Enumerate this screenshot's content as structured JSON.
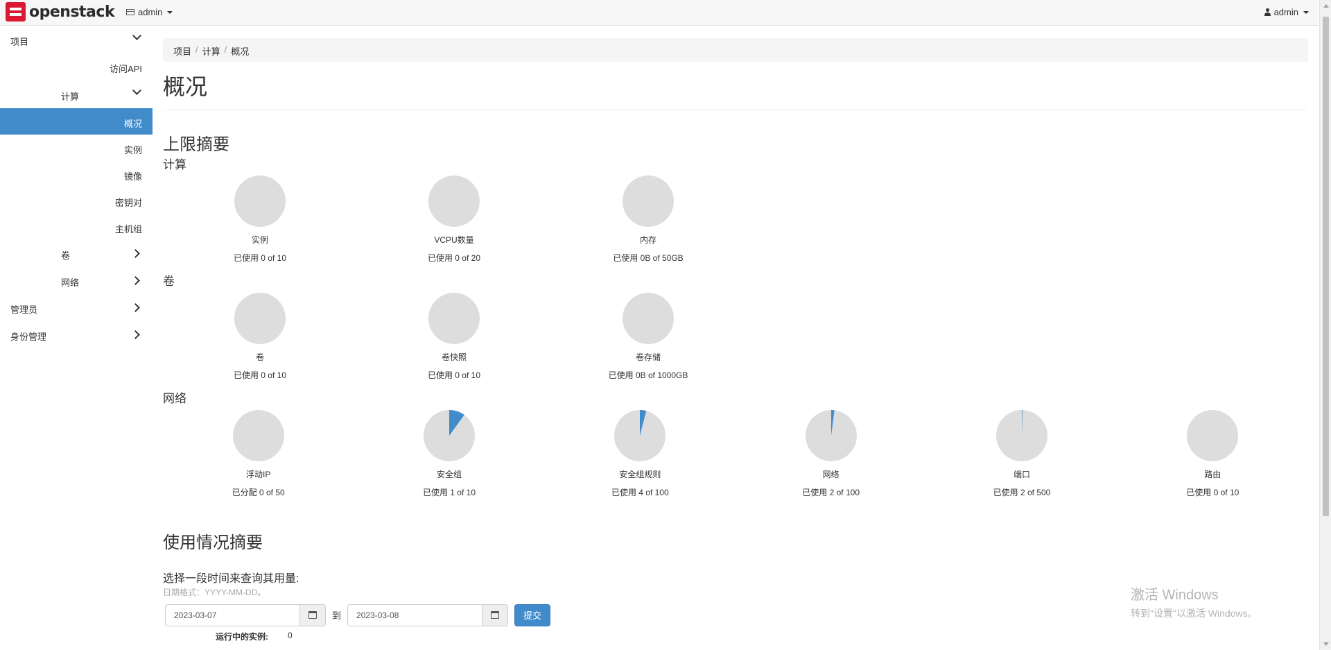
{
  "brand": {
    "name": "openstack"
  },
  "topbar": {
    "project_label": "admin",
    "user_label": "admin"
  },
  "sidebar": {
    "project": "项目",
    "api_access": "访问API",
    "compute": "计算",
    "compute_items": [
      "概况",
      "实例",
      "镜像",
      "密钥对",
      "主机组"
    ],
    "volumes": "卷",
    "network": "网络",
    "admin": "管理员",
    "identity": "身份管理"
  },
  "breadcrumb": [
    "项目",
    "计算",
    "概况"
  ],
  "page": {
    "title": "概况"
  },
  "limits": {
    "title": "上限摘要",
    "groups": [
      {
        "title": "计算",
        "items": [
          {
            "name": "实例",
            "usage": "已使用 0 of 10",
            "used": 0,
            "total": 10
          },
          {
            "name": "VCPU数量",
            "usage": "已使用 0 of 20",
            "used": 0,
            "total": 20
          },
          {
            "name": "内存",
            "usage": "已使用 0B of 50GB",
            "used": 0,
            "total": 50
          }
        ]
      },
      {
        "title": "卷",
        "items": [
          {
            "name": "卷",
            "usage": "已使用 0 of 10",
            "used": 0,
            "total": 10
          },
          {
            "name": "卷快照",
            "usage": "已使用 0 of 10",
            "used": 0,
            "total": 10
          },
          {
            "name": "卷存储",
            "usage": "已使用 0B of 1000GB",
            "used": 0,
            "total": 1000
          }
        ]
      },
      {
        "title": "网络",
        "items": [
          {
            "name": "浮动IP",
            "usage": "已分配 0 of 50",
            "used": 0,
            "total": 50
          },
          {
            "name": "安全组",
            "usage": "已使用 1 of 10",
            "used": 1,
            "total": 10
          },
          {
            "name": "安全组规则",
            "usage": "已使用 4 of 100",
            "used": 4,
            "total": 100
          },
          {
            "name": "网络",
            "usage": "已使用 2 of 100",
            "used": 2,
            "total": 100
          },
          {
            "name": "端口",
            "usage": "已使用 2 of 500",
            "used": 2,
            "total": 500
          },
          {
            "name": "路由",
            "usage": "已使用 0 of 10",
            "used": 0,
            "total": 10
          }
        ]
      }
    ],
    "colors": {
      "empty": "#dddddd",
      "used": "#428bca"
    }
  },
  "usage": {
    "title": "使用情况摘要",
    "query_label": "选择一段时间来查询其用量:",
    "date_help": "日期格式：YYYY-MM-DD。",
    "start_date": "2023-03-07",
    "to_label": "到",
    "end_date": "2023-03-08",
    "submit_label": "提交",
    "running_label": "运行中的实例:",
    "running_value": "0"
  },
  "watermark": {
    "line1": "激活 Windows",
    "line2": "转到\"设置\"以激活 Windows。"
  }
}
